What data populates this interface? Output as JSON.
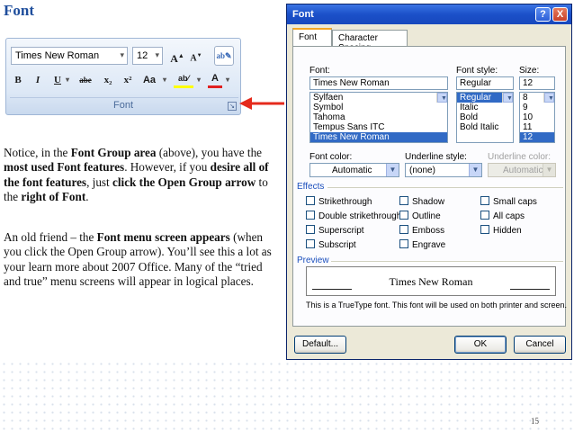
{
  "slide": {
    "title": "Font",
    "page_number": "15",
    "paragraph1": [
      {
        "t": "Notice, in the ",
        "b": false
      },
      {
        "t": "Font Group area",
        "b": true
      },
      {
        "t": " (above), you have the ",
        "b": false
      },
      {
        "t": "most used Font features",
        "b": true
      },
      {
        "t": ".  However, if you ",
        "b": false
      },
      {
        "t": "desire all of the font features",
        "b": true
      },
      {
        "t": ", just ",
        "b": false
      },
      {
        "t": "click the Open Group arrow",
        "b": true
      },
      {
        "t": " to the ",
        "b": false
      },
      {
        "t": "right of Font",
        "b": true
      },
      {
        "t": ".",
        "b": false
      }
    ],
    "paragraph2": [
      {
        "t": "An old friend – the ",
        "b": false
      },
      {
        "t": "Font menu screen appears",
        "b": true
      },
      {
        "t": " (when you click the Open Group arrow). You’ll see this a lot as your learn more about 2007 Office.  Many of the “tried and true” menu screens will appear in logical places.",
        "b": false
      }
    ]
  },
  "ribbon": {
    "font_name": "Times New Roman",
    "font_size": "12",
    "grow_label": "A",
    "shrink_label": "A",
    "bold": "B",
    "italic": "I",
    "underline": "U",
    "strike": "abe",
    "subscript": "x₂",
    "superscript": "x²",
    "change_case": "Aa",
    "highlight": "ab⁄",
    "font_color": "A",
    "group_label": "Font"
  },
  "dialog": {
    "title": "Font",
    "help": "?",
    "close": "X",
    "tabs": [
      "Font",
      "Character Spacing"
    ],
    "font_label": "Font:",
    "font_value": "Times New Roman",
    "font_list": [
      "Sylfaen",
      "Symbol",
      "Tahoma",
      "Tempus Sans ITC",
      "Times New Roman"
    ],
    "style_label": "Font style:",
    "style_value": "Regular",
    "style_list": [
      "Regular",
      "Italic",
      "Bold",
      "Bold Italic"
    ],
    "size_label": "Size:",
    "size_value": "12",
    "size_list": [
      "8",
      "9",
      "10",
      "11",
      "12"
    ],
    "color_label": "Font color:",
    "color_value": "Automatic",
    "underline_label": "Underline style:",
    "underline_value": "(none)",
    "ucolor_label": "Underline color:",
    "ucolor_value": "Automatic",
    "effects_label": "Effects",
    "effects": [
      [
        "Strikethrough",
        "Shadow",
        "Small caps"
      ],
      [
        "Double strikethrough",
        "Outline",
        "All caps"
      ],
      [
        "Superscript",
        "Emboss",
        "Hidden"
      ],
      [
        "Subscript",
        "Engrave"
      ]
    ],
    "preview_label": "Preview",
    "preview_text": "Times New Roman",
    "note": "This is a TrueType font. This font will be used on both printer and screen.",
    "default_btn": "Default...",
    "ok_btn": "OK",
    "cancel_btn": "Cancel"
  }
}
